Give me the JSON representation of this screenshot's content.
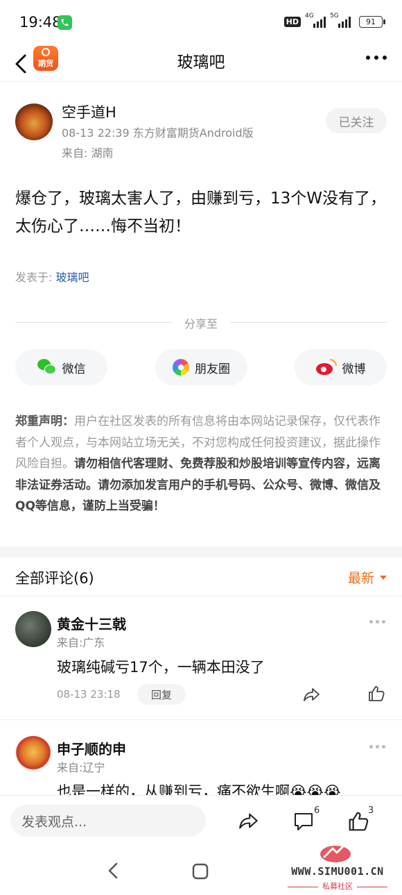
{
  "status_bar": {
    "time": "19:48",
    "hd": "HD",
    "net1": "4G",
    "net2": "5G",
    "battery": "91"
  },
  "nav": {
    "title": "玻璃吧",
    "app_logo_text": "期货"
  },
  "post": {
    "author_name": "空手道H",
    "meta": "08-13 22:39 东方财富期货Android版",
    "location": "来自: 湖南",
    "follow_label": "已关注",
    "content": "爆仓了，玻璃太害人了，由赚到亏，13个W没有了，太伤心了……悔不当初！",
    "origin_prefix": "发表于: ",
    "origin_link": "玻璃吧"
  },
  "share": {
    "label": "分享至",
    "wechat": "微信",
    "moments": "朋友圈",
    "weibo": "微博"
  },
  "disclaimer": {
    "label": "郑重声明：",
    "normal": "用户在社区发表的所有信息将由本网站记录保存，仅代表作者个人观点，与本网站立场无关，不对您构成任何投资建议，据此操作风险自担。",
    "bold": "请勿相信代客理财、免费荐股和炒股培训等宣传内容，远离非法证券活动。请勿添加发言用户的手机号码、公众号、微博、微信及QQ等信息，谨防上当受骗！"
  },
  "comments": {
    "title": "全部评论(6)",
    "sort": "最新",
    "items": [
      {
        "name": "黄金十三戟",
        "location": "来自:广东",
        "text": "玻璃纯碱亏17个，一辆本田没了",
        "time": "08-13 23:18",
        "reply": "回复"
      },
      {
        "name": "申子顺的申",
        "location": "来自:辽宁",
        "text": "也是一样的，从赚到亏，痛不欲生啊😭😭😭"
      }
    ]
  },
  "bottom_bar": {
    "input_placeholder": "发表观点...",
    "comment_count": "6",
    "like_count": "3"
  },
  "watermark": {
    "text": "WWW.SIMU001.CN",
    "sub": "私募社区"
  },
  "colors": {
    "accent": "#e8701e",
    "link": "#2a5ca8",
    "logo": "#f05418"
  }
}
